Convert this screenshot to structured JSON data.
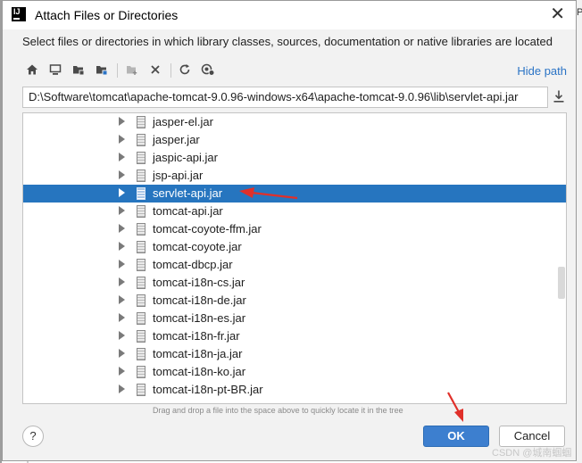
{
  "window": {
    "title": "Attach Files or Directories",
    "app_icon_label": "IJ",
    "close_glyph": "✕"
  },
  "description": "Select files or directories in which library classes, sources, documentation or native libraries are located",
  "toolbar": {
    "icons": [
      "home-icon",
      "desktop-icon",
      "project-icon",
      "module-icon",
      "new-folder-icon",
      "delete-icon",
      "refresh-icon",
      "show-hidden-icon"
    ],
    "hide_path": "Hide path"
  },
  "path": {
    "value": "D:\\Software\\tomcat\\apache-tomcat-9.0.96-windows-x64\\apache-tomcat-9.0.96\\lib\\servlet-api.jar"
  },
  "tree": {
    "items": [
      {
        "name": "jasper-el.jar",
        "selected": false
      },
      {
        "name": "jasper.jar",
        "selected": false
      },
      {
        "name": "jaspic-api.jar",
        "selected": false
      },
      {
        "name": "jsp-api.jar",
        "selected": false
      },
      {
        "name": "servlet-api.jar",
        "selected": true
      },
      {
        "name": "tomcat-api.jar",
        "selected": false
      },
      {
        "name": "tomcat-coyote-ffm.jar",
        "selected": false
      },
      {
        "name": "tomcat-coyote.jar",
        "selected": false
      },
      {
        "name": "tomcat-dbcp.jar",
        "selected": false
      },
      {
        "name": "tomcat-i18n-cs.jar",
        "selected": false
      },
      {
        "name": "tomcat-i18n-de.jar",
        "selected": false
      },
      {
        "name": "tomcat-i18n-es.jar",
        "selected": false
      },
      {
        "name": "tomcat-i18n-fr.jar",
        "selected": false
      },
      {
        "name": "tomcat-i18n-ja.jar",
        "selected": false
      },
      {
        "name": "tomcat-i18n-ko.jar",
        "selected": false
      },
      {
        "name": "tomcat-i18n-pt-BR.jar",
        "selected": false
      }
    ]
  },
  "hint": "Drag and drop a file into the space above to quickly locate it in the tree",
  "buttons": {
    "help": "?",
    "ok": "OK",
    "cancel": "Cancel"
  },
  "watermark": "CSDN @城南蝈蝈",
  "background_right_text": "PI",
  "colors": {
    "selection": "#2675bf",
    "ok_button": "#3d7fcf",
    "link": "#2a73c5",
    "annotation_arrow": "#e0302a"
  }
}
